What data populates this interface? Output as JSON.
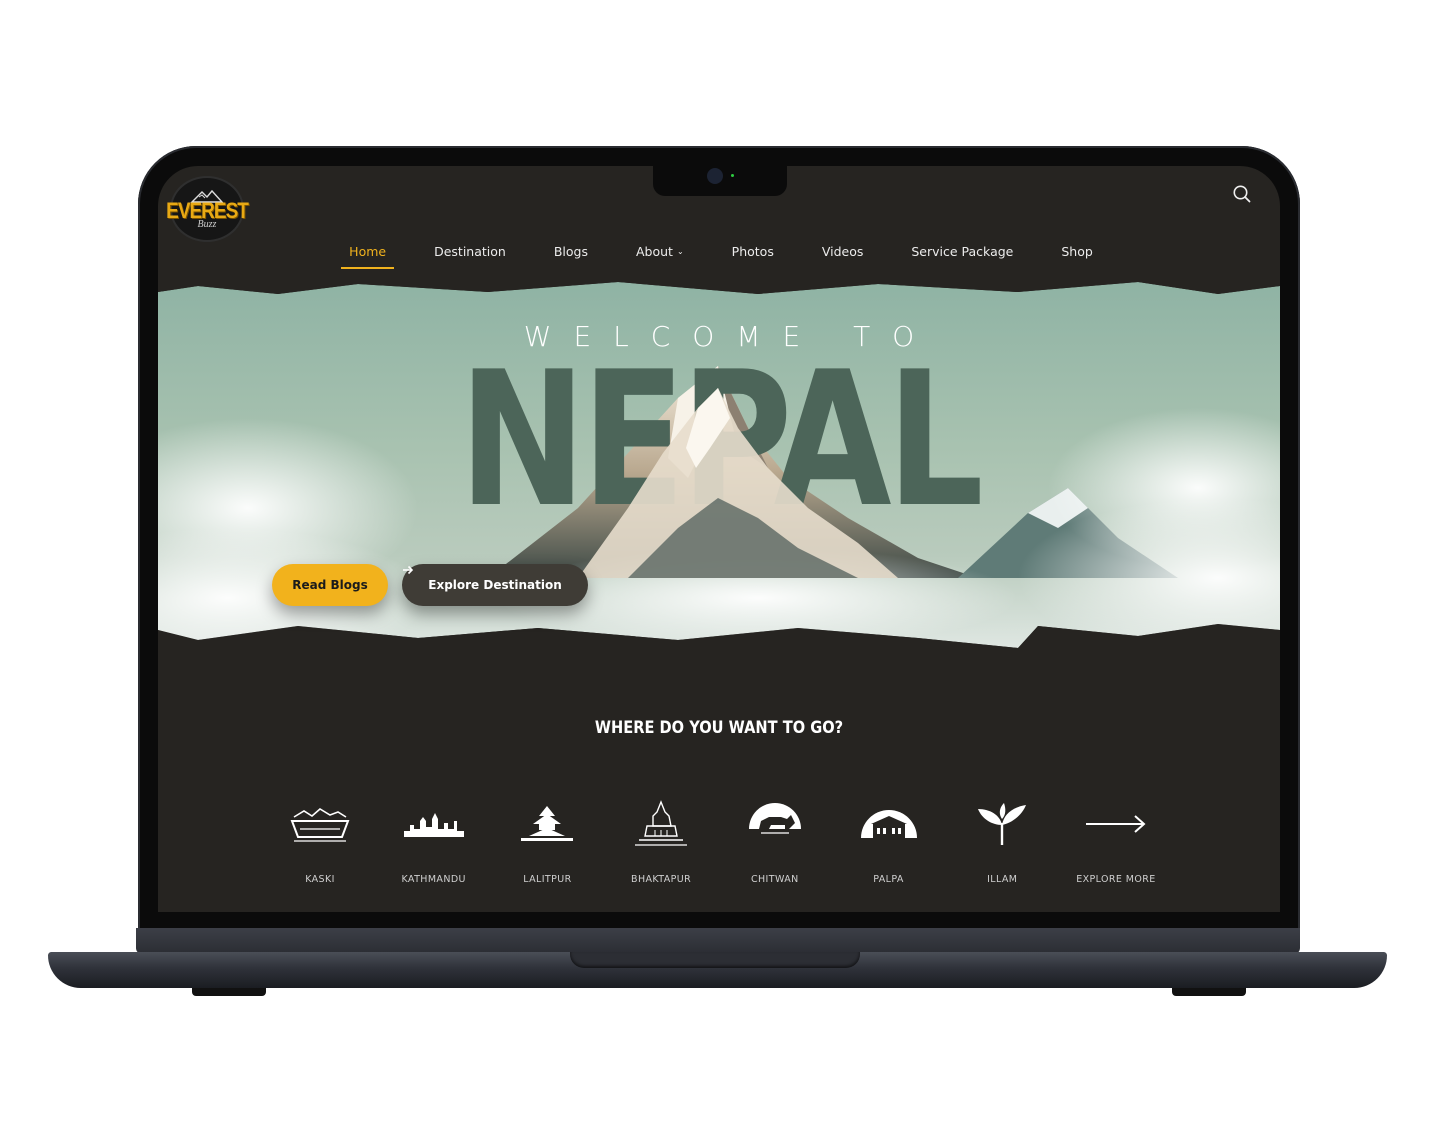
{
  "logo": {
    "word": "EVEREST",
    "sub": "Buzz"
  },
  "nav": {
    "items": [
      {
        "label": "Home",
        "active": true
      },
      {
        "label": "Destination"
      },
      {
        "label": "Blogs"
      },
      {
        "label": "About"
      },
      {
        "label": "Photos"
      },
      {
        "label": "Videos"
      },
      {
        "label": "Service Package"
      },
      {
        "label": "Shop"
      }
    ]
  },
  "hero": {
    "welcome": "WELCOME TO",
    "title": "NEPAL",
    "read_button": "Read Blogs",
    "explore_button": "Explore Destination"
  },
  "destinations": {
    "heading": "WHERE DO YOU WANT TO GO?",
    "items": [
      {
        "label": "KASKI",
        "icon": "boat-lake-icon"
      },
      {
        "label": "KATHMANDU",
        "icon": "city-skyline-icon"
      },
      {
        "label": "LALITPUR",
        "icon": "pagoda-temple-icon"
      },
      {
        "label": "BHAKTAPUR",
        "icon": "shikhara-temple-icon"
      },
      {
        "label": "CHITWAN",
        "icon": "rhino-icon"
      },
      {
        "label": "PALPA",
        "icon": "palace-icon"
      },
      {
        "label": "ILLAM",
        "icon": "tea-leaf-icon"
      },
      {
        "label": "EXPLORE MORE",
        "icon": "arrow-right-icon"
      }
    ]
  },
  "colors": {
    "accent": "#f2b21c",
    "background": "#262421",
    "nepal_text": "#4c6559"
  }
}
